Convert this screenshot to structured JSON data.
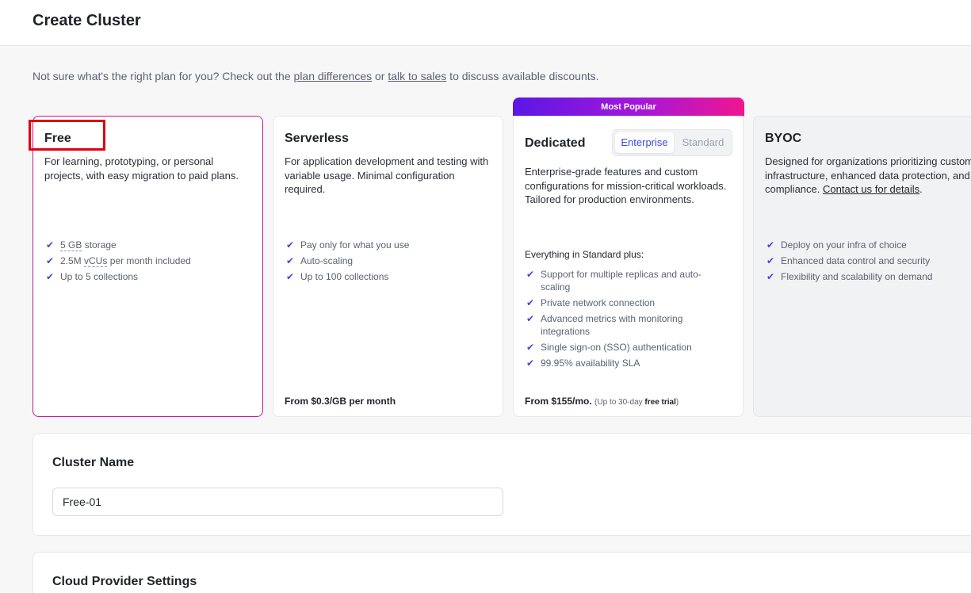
{
  "header": {
    "title": "Create Cluster"
  },
  "intro": {
    "before": "Not sure what's the right plan for you? Check out the ",
    "link1": "plan differences",
    "mid": " or ",
    "link2": "talk to sales",
    "after": " to discuss available discounts."
  },
  "plans": {
    "free": {
      "title": "Free",
      "description": "For learning, prototyping, or personal projects, with easy migration to paid plans.",
      "features": [
        {
          "pre": "",
          "u": "5 GB",
          "post": " storage"
        },
        {
          "pre": "2.5M ",
          "u": "vCUs",
          "post": " per month included"
        },
        {
          "pre": "Up to 5 collections",
          "u": "",
          "post": ""
        }
      ]
    },
    "serverless": {
      "title": "Serverless",
      "description": "For application development and testing with variable usage. Minimal configuration required.",
      "features": [
        "Pay only for what you use",
        "Auto-scaling",
        "Up to 100 collections"
      ],
      "price": "From $0.3/GB per month"
    },
    "dedicated": {
      "badge": "Most Popular",
      "title": "Dedicated",
      "toggle_on": "Enterprise",
      "toggle_off": "Standard",
      "description": "Enterprise-grade features and custom configurations for mission-critical workloads. Tailored for production environments.",
      "plus_label": "Everything in Standard plus:",
      "features": [
        "Support for multiple replicas and auto-scaling",
        "Private network connection",
        "Advanced metrics with monitoring integrations",
        "Single sign-on (SSO) authentication",
        "99.95% availability SLA"
      ],
      "price": "From $155/mo.",
      "trial_pre": "(Up to 30-day ",
      "trial_bold": "free trial",
      "trial_post": ")"
    },
    "byoc": {
      "title": "BYOC",
      "description": "Designed for organizations prioritizing custom infrastructure, enhanced data protection, and compliance. ",
      "contact_link": "Contact us for details",
      "period": ".",
      "features": [
        "Deploy on your infra of choice",
        "Enhanced data control and security",
        "Flexibility and scalability on demand"
      ]
    }
  },
  "cluster_name": {
    "title": "Cluster Name",
    "value": "Free-01"
  },
  "cloud": {
    "title": "Cloud Provider Settings"
  },
  "check_glyph": "✔",
  "colors": {
    "accent": "#3b49df",
    "free_border": "#c4189a",
    "highlight": "#e0000f"
  }
}
